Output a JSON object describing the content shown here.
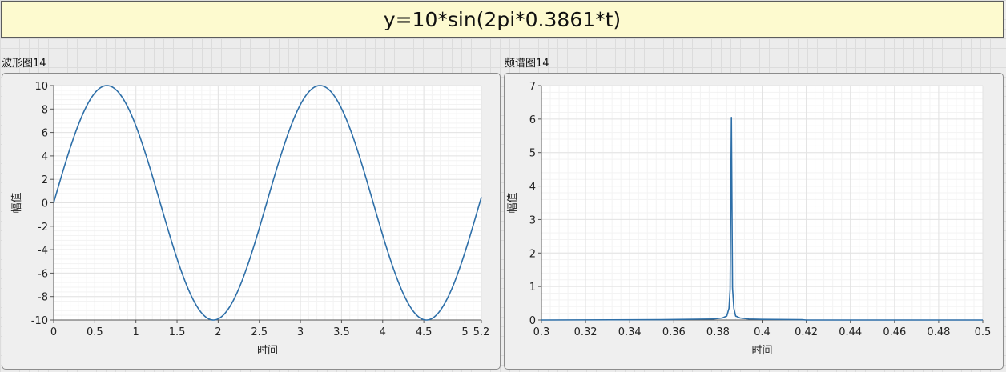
{
  "banner": {
    "text": "y=10*sin(2pi*0.3861*t)"
  },
  "graphs": [
    {
      "caption": "波形图14"
    },
    {
      "caption": "频谱图14"
    }
  ],
  "colors": {
    "trace": "#2e6fa8",
    "plot_bg": "#ffffff",
    "grid_major": "#e3e3e3",
    "grid_minor": "#f3f3f3",
    "banner_bg": "#fdfacf"
  },
  "chart_data": [
    {
      "type": "line",
      "title": "波形图14",
      "xlabel": "时间",
      "ylabel": "幅值",
      "xlim": [
        0,
        5.2
      ],
      "ylim": [
        -10,
        10
      ],
      "xticks": [
        "0",
        "0.5",
        "1",
        "1.5",
        "2",
        "2.5",
        "3",
        "3.5",
        "4",
        "4.5",
        "5",
        "5.2"
      ],
      "xtick_values": [
        0,
        0.5,
        1,
        1.5,
        2,
        2.5,
        3,
        3.5,
        4,
        4.5,
        5,
        5.2
      ],
      "yticks": [
        "10",
        "8",
        "6",
        "4",
        "2",
        "0",
        "-2",
        "-4",
        "-6",
        "-8",
        "-10"
      ],
      "ytick_values": [
        10,
        8,
        6,
        4,
        2,
        0,
        -2,
        -4,
        -6,
        -8,
        -10
      ],
      "grid": true,
      "series": [
        {
          "function": "10*sin(2*pi*0.3861*t)",
          "amplitude": 10,
          "frequency": 0.3861,
          "x": [
            0,
            0.2,
            0.4,
            0.6,
            0.648,
            0.8,
            1.0,
            1.2,
            1.4,
            1.6,
            1.8,
            1.943,
            2.0,
            2.2,
            2.4,
            2.6,
            2.8,
            3.0,
            3.238,
            3.4,
            3.6,
            3.8,
            4.0,
            4.2,
            4.4,
            4.533,
            4.6,
            4.8,
            5.0,
            5.2
          ],
          "y": [
            0,
            4.69,
            8.27,
            9.97,
            10,
            9.12,
            6.64,
            2.82,
            -1.55,
            -5.66,
            -8.76,
            -10,
            -9.87,
            -8.71,
            -5.57,
            -1.44,
            2.94,
            6.76,
            10,
            9.04,
            6.55,
            2.71,
            -1.6,
            -5.67,
            -8.8,
            -10,
            -9.84,
            -8.7,
            -5.51,
            -1.31
          ]
        }
      ]
    },
    {
      "type": "line",
      "title": "频谱图14",
      "xlabel": "时间",
      "ylabel": "幅值",
      "xlim": [
        0.3,
        0.5
      ],
      "ylim": [
        0,
        7
      ],
      "xticks": [
        "0.3",
        "0.32",
        "0.34",
        "0.36",
        "0.38",
        "0.4",
        "0.42",
        "0.44",
        "0.46",
        "0.48",
        "0.5"
      ],
      "xtick_values": [
        0.3,
        0.32,
        0.34,
        0.36,
        0.38,
        0.4,
        0.42,
        0.44,
        0.46,
        0.48,
        0.5
      ],
      "yticks": [
        "7",
        "6",
        "5",
        "4",
        "3",
        "2",
        "1",
        "0"
      ],
      "ytick_values": [
        7,
        6,
        5,
        4,
        3,
        2,
        1,
        0
      ],
      "grid": true,
      "series": [
        {
          "x": [
            0.3,
            0.354,
            0.378,
            0.382,
            0.384,
            0.385,
            0.3855,
            0.3861,
            0.3866,
            0.3872,
            0.388,
            0.39,
            0.394,
            0.4,
            0.418,
            0.42,
            0.5
          ],
          "y": [
            0,
            0.01,
            0.03,
            0.06,
            0.12,
            0.35,
            0.9,
            6.05,
            0.95,
            0.35,
            0.12,
            0.06,
            0.03,
            0.02,
            0.01,
            0,
            0
          ]
        }
      ]
    }
  ]
}
